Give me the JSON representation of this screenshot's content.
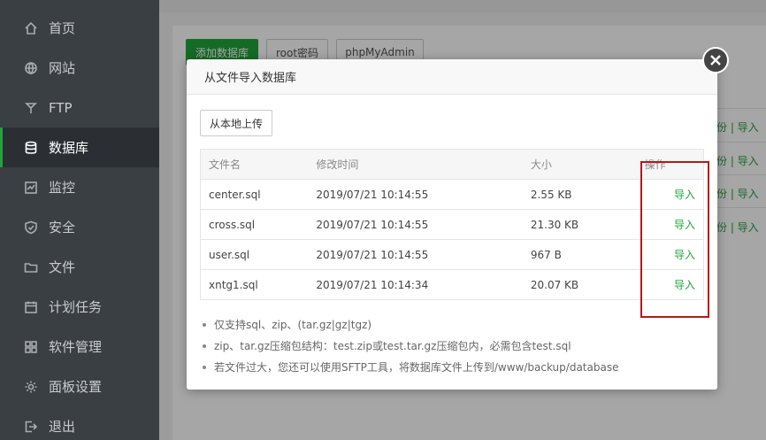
{
  "sidebar": {
    "items": [
      {
        "label": "首页",
        "icon": "home-icon"
      },
      {
        "label": "网站",
        "icon": "globe-icon"
      },
      {
        "label": "FTP",
        "icon": "ftp-icon"
      },
      {
        "label": "数据库",
        "icon": "database-icon",
        "active": true
      },
      {
        "label": "监控",
        "icon": "monitor-icon"
      },
      {
        "label": "安全",
        "icon": "shield-icon"
      },
      {
        "label": "文件",
        "icon": "folder-icon"
      },
      {
        "label": "计划任务",
        "icon": "calendar-icon"
      },
      {
        "label": "软件管理",
        "icon": "grid-icon"
      },
      {
        "label": "面板设置",
        "icon": "gear-icon"
      },
      {
        "label": "退出",
        "icon": "logout-icon"
      }
    ]
  },
  "toolbar": {
    "add_db": "添加数据库",
    "root_pwd": "root密码",
    "phpmyadmin": "phpMyAdmin"
  },
  "bg_rows": [
    {
      "text": "份 | 导入"
    },
    {
      "text": "份 | 导入"
    },
    {
      "text": "份 | 导入"
    },
    {
      "text": "份 | 导入"
    }
  ],
  "modal": {
    "title": "从文件导入数据库",
    "upload_label": "从本地上传",
    "columns": {
      "name": "文件名",
      "mtime": "修改时间",
      "size": "大小",
      "op": "操作"
    },
    "files": [
      {
        "name": "center.sql",
        "mtime": "2019/07/21 10:14:55",
        "size": "2.55 KB",
        "action": "导入"
      },
      {
        "name": "cross.sql",
        "mtime": "2019/07/21 10:14:55",
        "size": "21.30 KB",
        "action": "导入"
      },
      {
        "name": "user.sql",
        "mtime": "2019/07/21 10:14:55",
        "size": "967 B",
        "action": "导入"
      },
      {
        "name": "xntg1.sql",
        "mtime": "2019/07/21 10:14:34",
        "size": "20.07 KB",
        "action": "导入"
      }
    ],
    "notes": [
      "仅支持sql、zip、(tar.gz|gz|tgz)",
      "zip、tar.gz压缩包结构：test.zip或test.tar.gz压缩包内，必需包含test.sql",
      "若文件过大，您还可以使用SFTP工具，将数据库文件上传到/www/backup/database"
    ]
  },
  "colors": {
    "accent": "#20a53a",
    "sidebar": "#3a3f44",
    "highlight": "#b7171b"
  }
}
